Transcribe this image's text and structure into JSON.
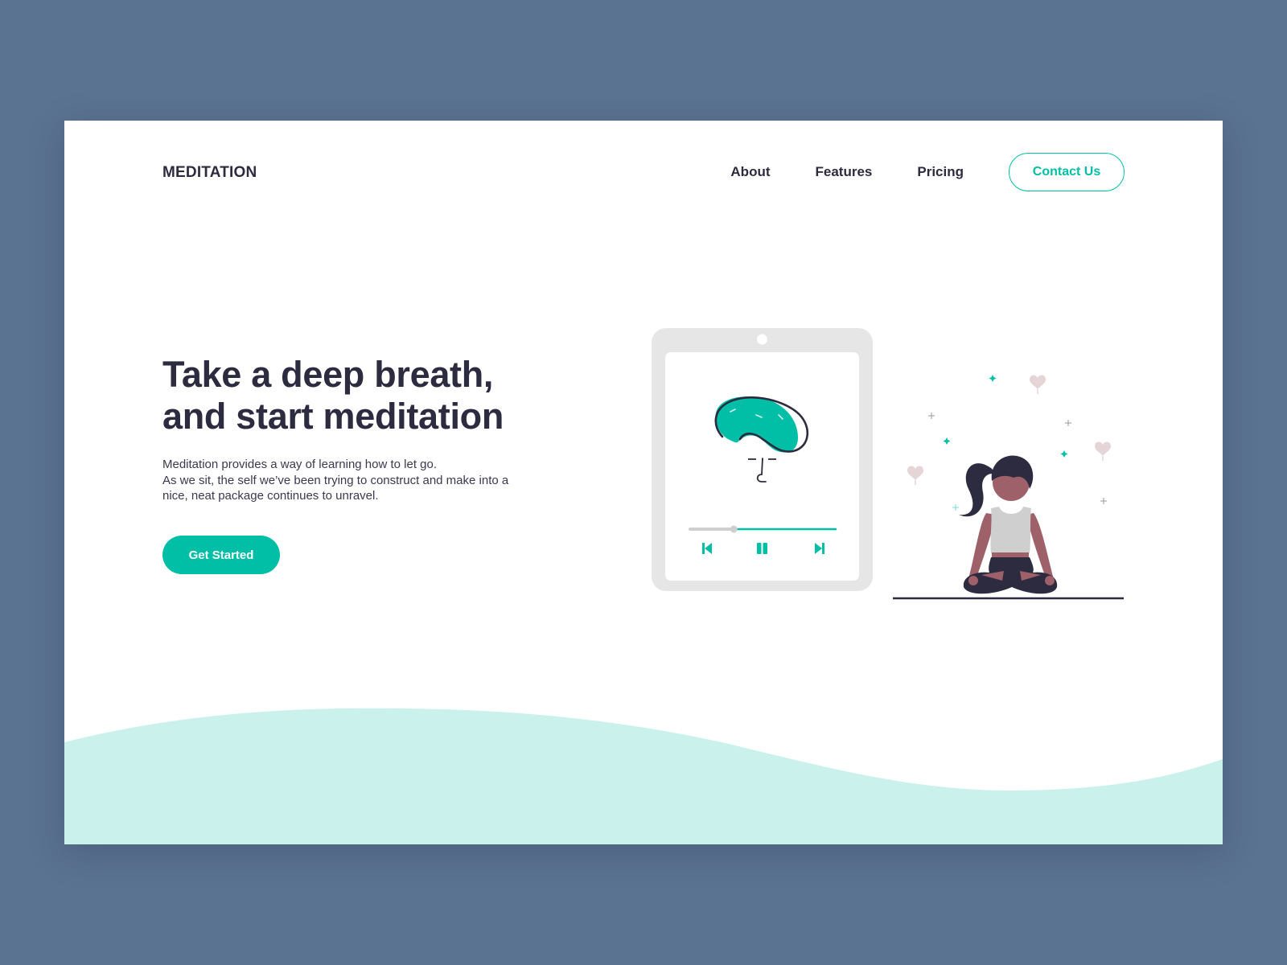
{
  "brand": {
    "logo_text": "MEDITATION"
  },
  "nav": {
    "items": [
      {
        "label": "About"
      },
      {
        "label": "Features"
      },
      {
        "label": "Pricing"
      }
    ],
    "contact_label": "Contact Us"
  },
  "hero": {
    "title_lines": [
      "Take a deep breath,",
      "and start meditation"
    ],
    "description_lines": [
      "Meditation provides a way of learning how to let go.",
      "As we sit, the self we’ve been trying to construct and make into a",
      "nice, neat package continues to unravel."
    ],
    "cta_label": "Get Started"
  },
  "player": {
    "progress_fraction": 0.3,
    "controls": [
      "skip-back",
      "pause",
      "skip-forward"
    ]
  },
  "colors": {
    "background": "#5a7391",
    "accent": "#00bfa6",
    "text_dark": "#2d2b3f",
    "wave": "#cbf1ec",
    "device_frame": "#e6e6e6",
    "skin": "#9e616a",
    "tank_top": "#cfcfcf",
    "heart": "#e6d5d7"
  }
}
